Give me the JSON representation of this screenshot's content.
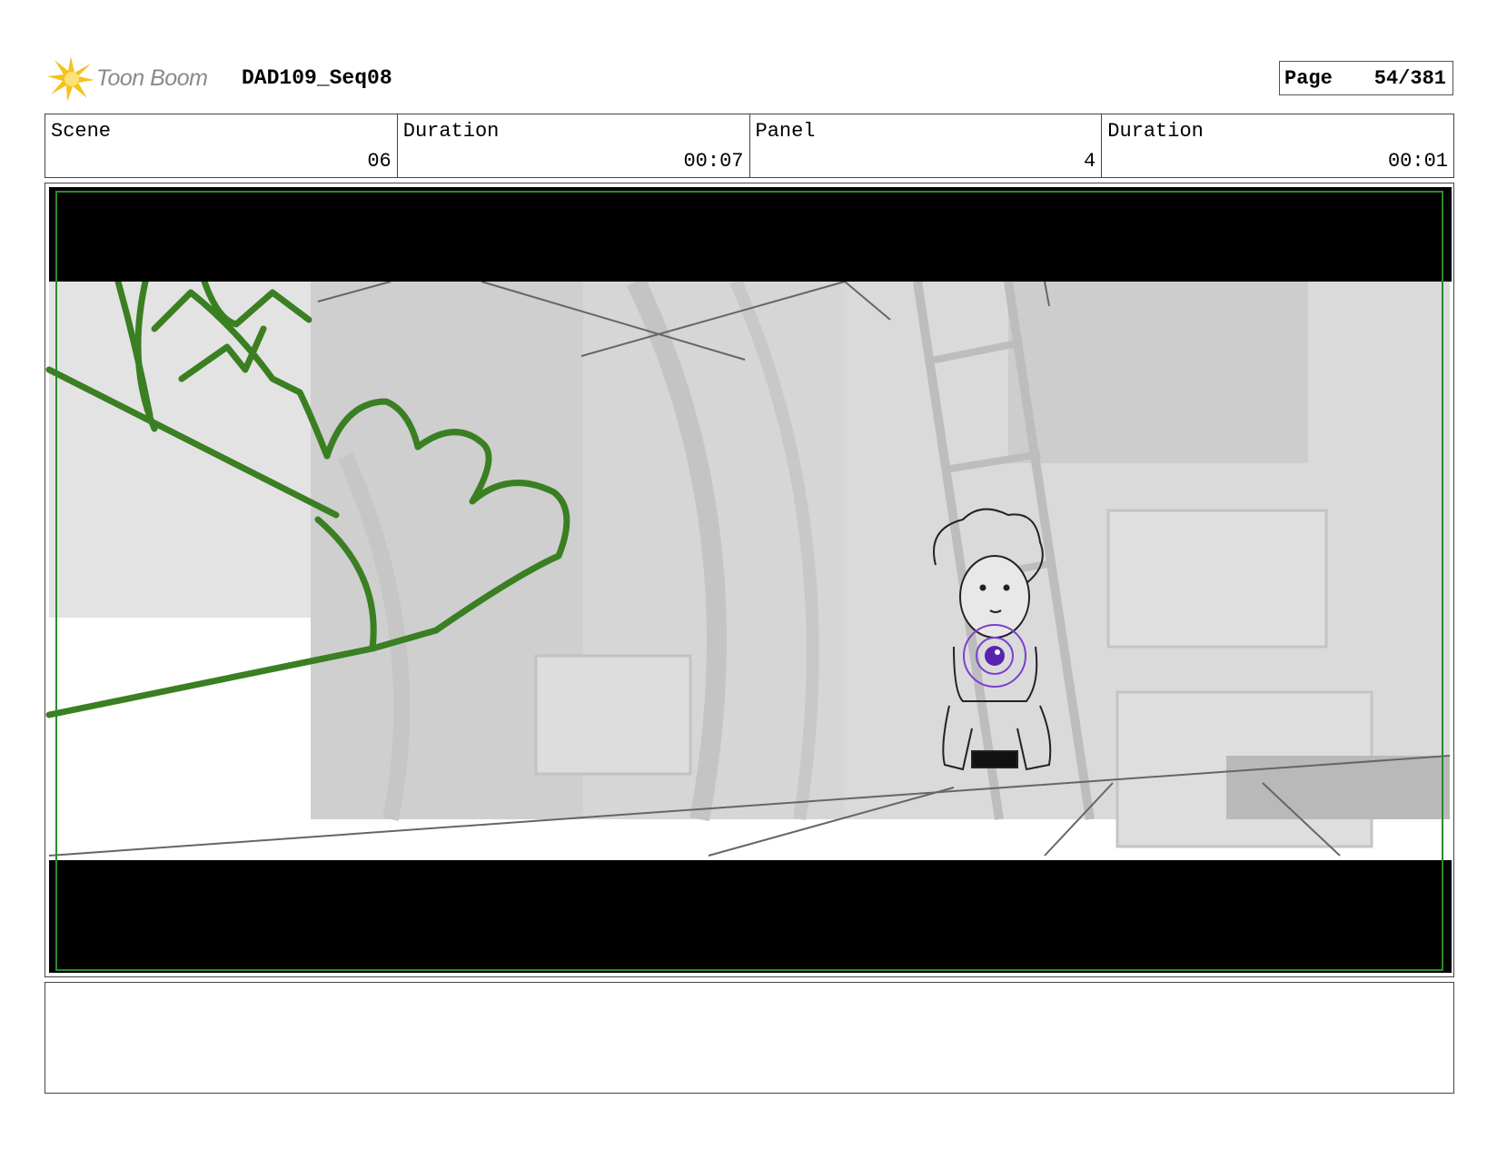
{
  "header": {
    "logo_text": "Toon Boom",
    "title": "DAD109_Seq08",
    "page_label": "Page",
    "page_value": "54/381"
  },
  "info": {
    "scene_label": "Scene",
    "scene_value": "06",
    "scene_duration_label": "Duration",
    "scene_duration_value": "00:07",
    "panel_label": "Panel",
    "panel_value": "4",
    "panel_duration_label": "Duration",
    "panel_duration_value": "00:01"
  },
  "notes": {
    "text": ""
  }
}
